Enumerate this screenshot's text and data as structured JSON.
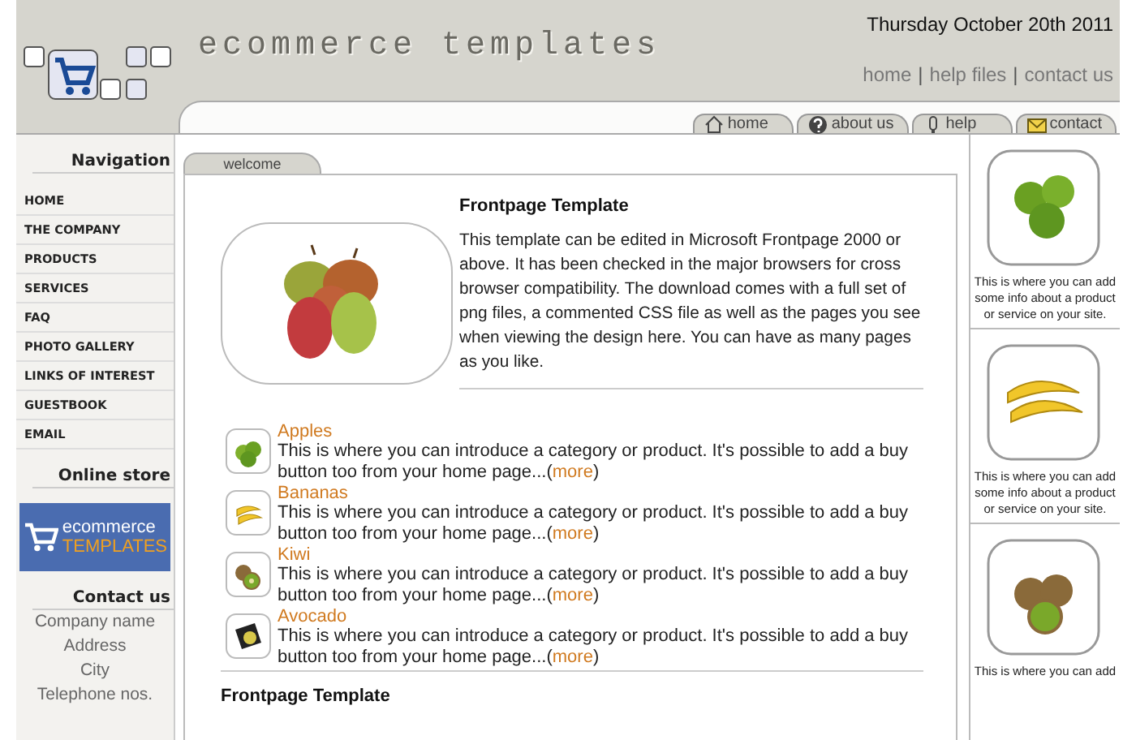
{
  "header": {
    "title": "ecommerce templates",
    "date": "Thursday October 20th 2011",
    "top_links": [
      "home",
      "help files",
      "contact us"
    ],
    "link_separator": "|"
  },
  "tabs": [
    {
      "label": "home"
    },
    {
      "label": "about us"
    },
    {
      "label": "help"
    },
    {
      "label": "contact"
    }
  ],
  "sidebar": {
    "nav_title": "Navigation",
    "nav_items": [
      "HOME",
      "THE COMPANY",
      "PRODUCTS",
      "SERVICES",
      "FAQ",
      "PHOTO GALLERY",
      "LINKS OF INTEREST",
      "GUESTBOOK",
      "EMAIL"
    ],
    "store_title": "Online store",
    "banner": {
      "line_1": "ecommerce",
      "line_2": "TEMPLATES"
    },
    "contact_title": "Contact us",
    "contact_lines": [
      "Company name",
      "Address",
      "City",
      "Telephone nos."
    ]
  },
  "content": {
    "tab": "welcome",
    "intro": {
      "heading": "Frontpage Template",
      "text": "This template can be edited in Microsoft Frontpage 2000 or above. It has been checked in the major browsers for cross browser compatibility. The download comes with a full set of png files, a commented CSS file as well as the pages you see when viewing the design here. You can have as many pages as you like."
    },
    "products": [
      {
        "name": "Apples",
        "text": "This is where you can introduce a category or product. It's possible to add a buy button too from your home page...(",
        "link": "more",
        "text_after": ")"
      },
      {
        "name": "Bananas",
        "text": "This is where you can introduce a category or product. It's possible to add a buy button too from your home page...(",
        "link": "more",
        "text_after": ")"
      },
      {
        "name": "Kiwi",
        "text": "This is where you can introduce a category or product. It's possible to add a buy button too from your home page...(",
        "link": "more",
        "text_after": ")"
      },
      {
        "name": "Avocado",
        "text": "This is where you can introduce a category or product. It's possible to add a buy button too from your home page...(",
        "link": "more",
        "text_after": ")"
      }
    ],
    "bottom_heading": "Frontpage Template"
  },
  "right_cards": [
    {
      "text": "This is where you can add some info about a product or service on your site."
    },
    {
      "text": "This is where you can add some info about a product or service on your site."
    },
    {
      "text": "This is where you can add"
    }
  ]
}
